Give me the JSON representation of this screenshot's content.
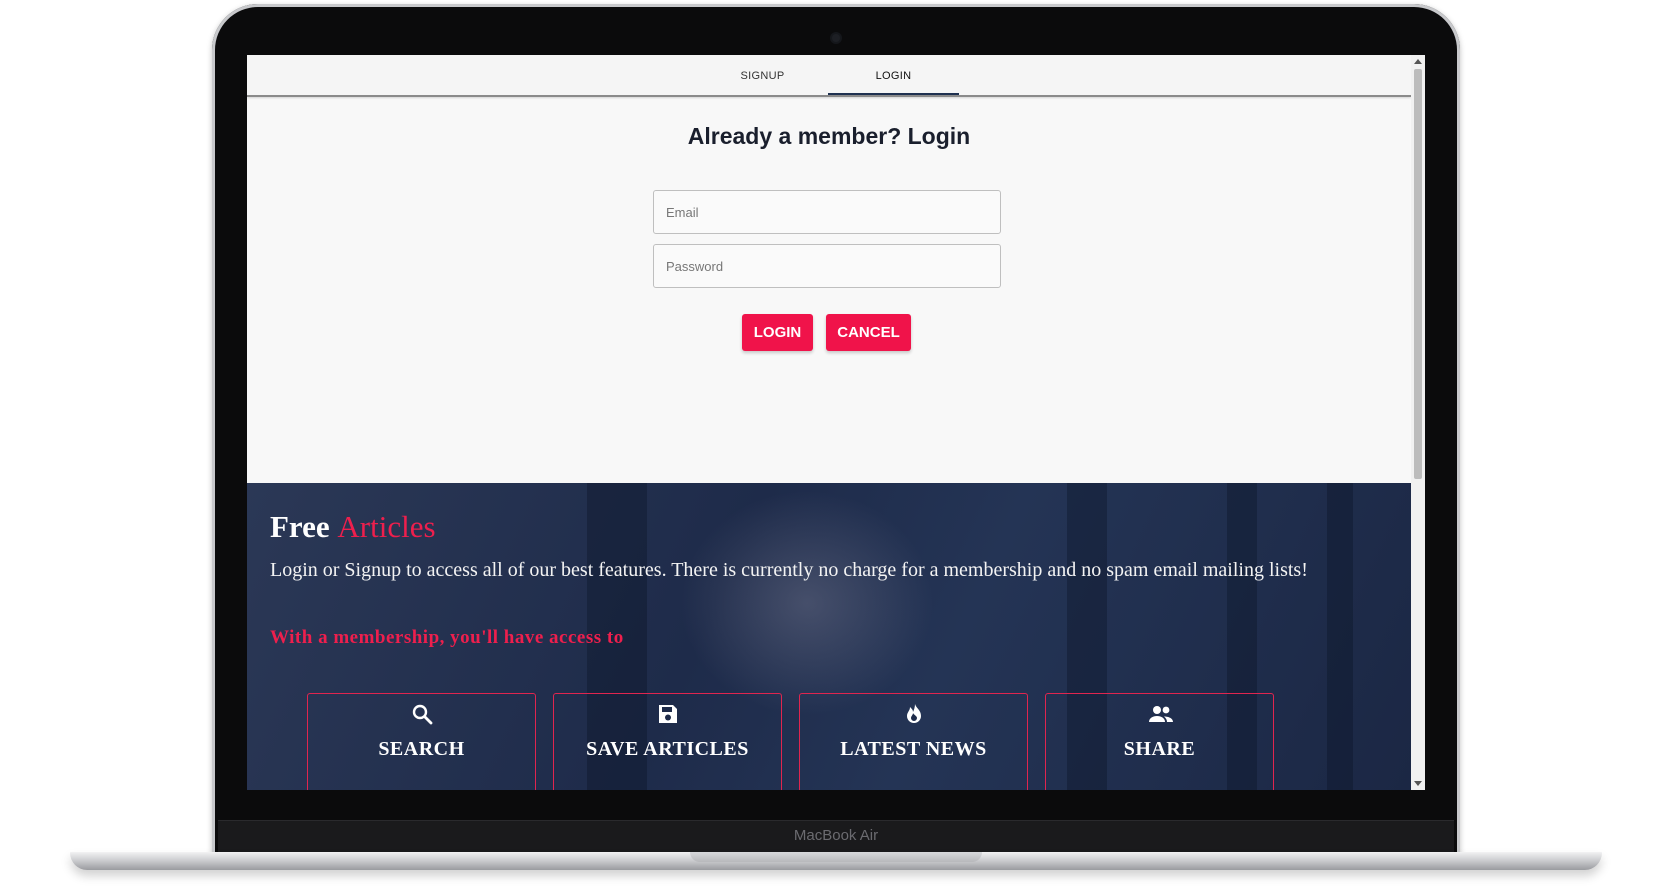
{
  "device": {
    "label": "MacBook Air"
  },
  "tabs": [
    {
      "label": "SIGNUP",
      "active": false
    },
    {
      "label": "LOGIN",
      "active": true
    }
  ],
  "login": {
    "title": "Already a member? Login",
    "email_placeholder": "Email",
    "password_placeholder": "Password",
    "login_label": "LOGIN",
    "cancel_label": "CANCEL",
    "button_color": "#f0134a"
  },
  "hero": {
    "title_main": "Free",
    "title_accent": "Articles",
    "description": "Login or Signup to access all of our best features. There is currently no charge for a membership and no spam email mailing lists!",
    "subtitle": "With a membership, you'll have access to",
    "accent_color": "#ee1f4d"
  },
  "features": [
    {
      "icon": "search-icon",
      "label": "SEARCH"
    },
    {
      "icon": "save-icon",
      "label": "SAVE ARTICLES"
    },
    {
      "icon": "fire-icon",
      "label": "LATEST NEWS"
    },
    {
      "icon": "people-icon",
      "label": "SHARE"
    }
  ]
}
